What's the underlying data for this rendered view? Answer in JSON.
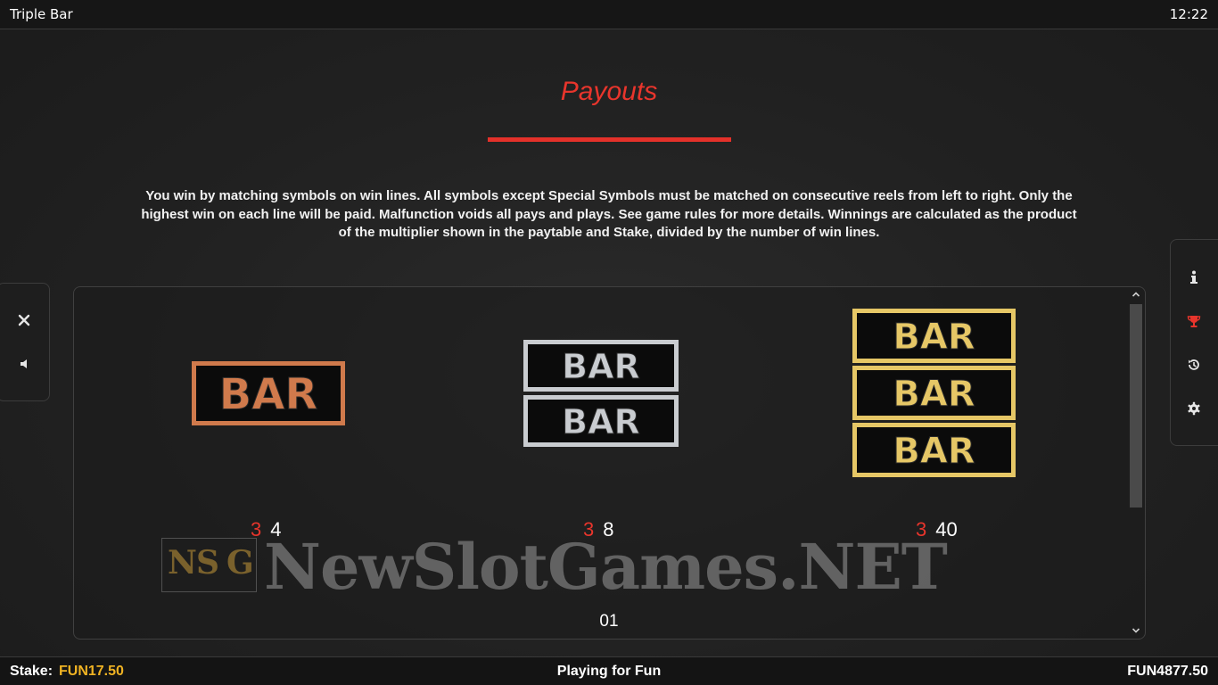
{
  "app": {
    "title": "Triple Bar",
    "clock": "12:22"
  },
  "heading": "Payouts",
  "description": "You win by matching symbols on win lines. All symbols except Special Symbols must be matched on consecutive reels from left to right. Only the highest win on each line will be paid. Malfunction voids all pays and plays. See game rules for more details. Winnings are calculated as the product of the multiplier shown in the paytable and Stake, divided by the number of win lines.",
  "left_panel": {
    "buttons": [
      {
        "icon": "close-icon"
      },
      {
        "icon": "speaker-icon"
      }
    ]
  },
  "right_panel": {
    "buttons": [
      {
        "icon": "info-icon"
      },
      {
        "icon": "trophy-icon",
        "active_color": "#e8352c"
      },
      {
        "icon": "history-icon"
      },
      {
        "icon": "gear-icon"
      }
    ]
  },
  "symbols": [
    {
      "name": "Single Bar",
      "bar_text": "BAR",
      "bars": 1,
      "frame_color": "#d07a4c",
      "payout": {
        "count": "3",
        "multiplier": "4"
      }
    },
    {
      "name": "Double Bar",
      "bar_text": "BAR",
      "bars": 2,
      "frame_color": "#c9ccd0",
      "payout": {
        "count": "3",
        "multiplier": "8"
      }
    },
    {
      "name": "Triple Bar",
      "bar_text": "BAR",
      "bars": 3,
      "frame_color": "#e6c766",
      "payout": {
        "count": "3",
        "multiplier": "40"
      }
    }
  ],
  "page_number": "01",
  "watermark": {
    "logo_letters": [
      "N",
      "S",
      "G"
    ],
    "text": "NewSlotGames.NET"
  },
  "footer": {
    "stake_label": "Stake:",
    "stake_value": "FUN17.50",
    "status": "Playing for Fun",
    "balance": "FUN4877.50"
  },
  "colors": {
    "accent_red": "#e8352c",
    "stake_gold": "#f0b323"
  }
}
